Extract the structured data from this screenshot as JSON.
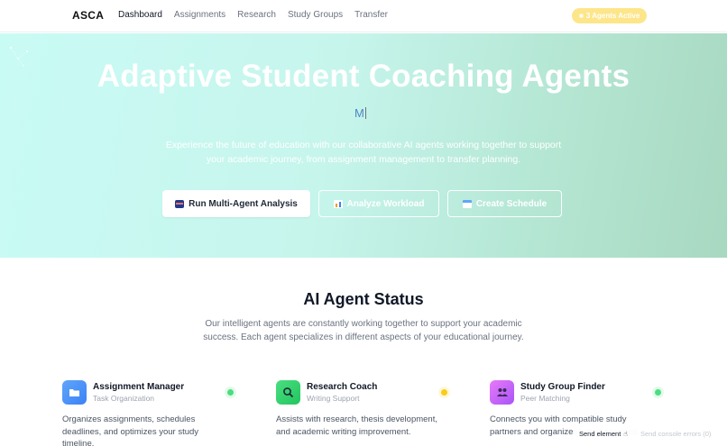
{
  "nav": {
    "logo": "ASCA",
    "links": [
      "Dashboard",
      "Assignments",
      "Research",
      "Study Groups",
      "Transfer"
    ],
    "active_link": "Dashboard",
    "badge": {
      "icon": "robot-icon",
      "label": "3 Agents Active"
    }
  },
  "hero": {
    "title": "Adaptive Student Coaching Agents",
    "typed_text": "M",
    "subtitle": "Experience the future of education with our collaborative AI agents working together to support your academic journey, from assignment management to transfer planning.",
    "buttons": [
      {
        "icon": "robot-icon",
        "label": "Run Multi-Agent Analysis"
      },
      {
        "icon": "chart-icon",
        "label": "Analyze Workload"
      },
      {
        "icon": "calendar-icon",
        "label": "Create Schedule"
      }
    ]
  },
  "status": {
    "title": "AI Agent Status",
    "description": "Our intelligent agents are constantly working together to support your academic success. Each agent specializes in different aspects of your educational journey.",
    "agents": [
      {
        "name": "Assignment Manager",
        "role": "Task Organization",
        "icon": "folder-icon",
        "status_color": "#4ade80",
        "description": "Organizes assignments, schedules deadlines, and optimizes your study timeline."
      },
      {
        "name": "Research Coach",
        "role": "Writing Support",
        "icon": "search-icon",
        "status_color": "#facc15",
        "description": "Assists with research, thesis development, and academic writing improvement."
      },
      {
        "name": "Study Group Finder",
        "role": "Peer Matching",
        "icon": "people-icon",
        "status_color": "#4ade80",
        "description": "Connects you with compatible study partners and organizes group sessions."
      }
    ]
  },
  "console": {
    "send_element": "Send element",
    "send_errors": "Send console errors (0)"
  },
  "colors": {
    "hero_gradient_start": "#c9fbf5",
    "hero_gradient_end": "#a8d8c0",
    "badge_bg": "#fde68a"
  }
}
